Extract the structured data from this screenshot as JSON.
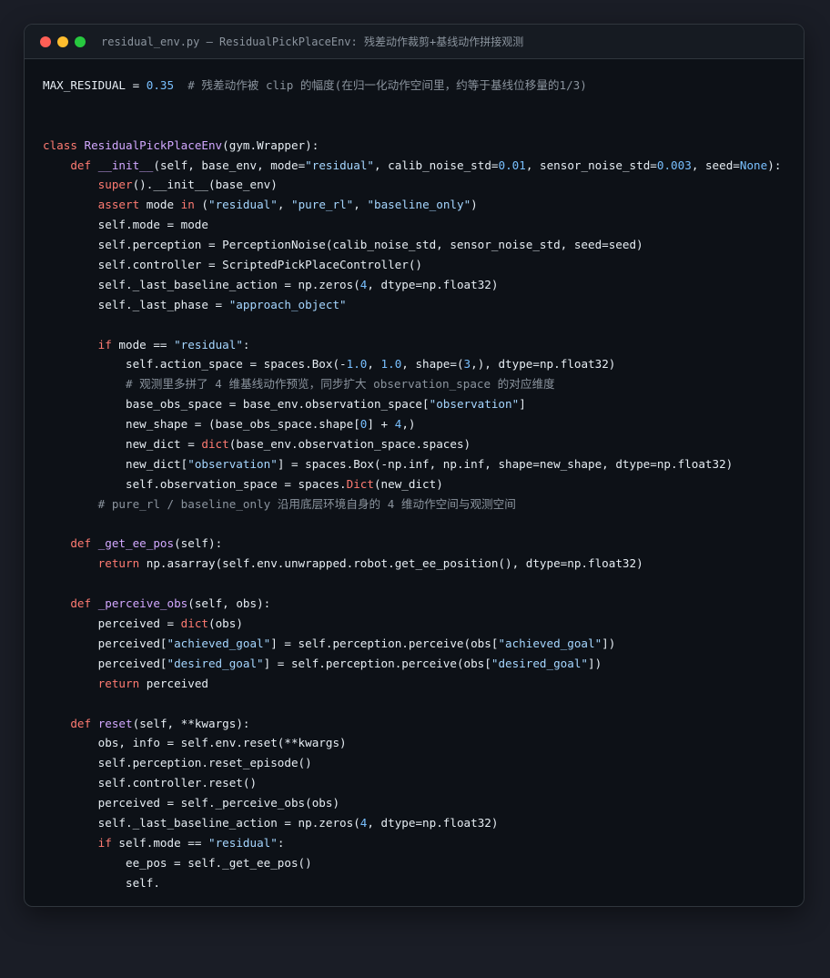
{
  "window": {
    "title": "residual_env.py — ResidualPickPlaceEnv: 残差动作裁剪+基线动作拼接观测"
  },
  "code_lines": [
    [
      [
        "MAX_RESIDUAL = ",
        ""
      ],
      [
        "0.35",
        "n"
      ],
      [
        "  # 残差动作被 clip 的幅度(在归一化动作空间里，约等于基线位移量的1/3)",
        "c"
      ]
    ],
    [],
    [],
    [
      [
        "class ",
        "k"
      ],
      [
        "ResidualPickPlaceEnv",
        "f"
      ],
      [
        "(gym.Wrapper):",
        ""
      ]
    ],
    [
      [
        "    ",
        ""
      ],
      [
        "def ",
        "k"
      ],
      [
        "__init__",
        "f"
      ],
      [
        "(self, base_env, mode=",
        ""
      ],
      [
        "\"residual\"",
        "s"
      ],
      [
        ", calib_noise_std=",
        ""
      ],
      [
        "0.01",
        "n"
      ],
      [
        ", sensor_noise_std=",
        ""
      ],
      [
        "0.003",
        "n"
      ],
      [
        ", seed=",
        ""
      ],
      [
        "None",
        "n"
      ],
      [
        "):",
        ""
      ]
    ],
    [
      [
        "        ",
        ""
      ],
      [
        "super",
        "k"
      ],
      [
        "().__init__(base_env)",
        ""
      ]
    ],
    [
      [
        "        ",
        ""
      ],
      [
        "assert ",
        "k"
      ],
      [
        "mode ",
        ""
      ],
      [
        "in ",
        "k"
      ],
      [
        "(",
        ""
      ],
      [
        "\"residual\"",
        "s"
      ],
      [
        ", ",
        ""
      ],
      [
        "\"pure_rl\"",
        "s"
      ],
      [
        ", ",
        ""
      ],
      [
        "\"baseline_only\"",
        "s"
      ],
      [
        ")",
        ""
      ]
    ],
    [
      [
        "        self.mode = mode",
        ""
      ]
    ],
    [
      [
        "        self.perception = PerceptionNoise(calib_noise_std, sensor_noise_std, seed=seed)",
        ""
      ]
    ],
    [
      [
        "        self.controller = ScriptedPickPlaceController()",
        ""
      ]
    ],
    [
      [
        "        self._last_baseline_action = np.zeros(",
        ""
      ],
      [
        "4",
        "n"
      ],
      [
        ", dtype=np.float32)",
        ""
      ]
    ],
    [
      [
        "        self._last_phase = ",
        ""
      ],
      [
        "\"approach_object\"",
        "s"
      ]
    ],
    [],
    [
      [
        "        ",
        ""
      ],
      [
        "if ",
        "k"
      ],
      [
        "mode == ",
        ""
      ],
      [
        "\"residual\"",
        "s"
      ],
      [
        ":",
        ""
      ]
    ],
    [
      [
        "            self.action_space = spaces.Box(-",
        ""
      ],
      [
        "1.0",
        "n"
      ],
      [
        ", ",
        ""
      ],
      [
        "1.0",
        "n"
      ],
      [
        ", shape=(",
        ""
      ],
      [
        "3",
        "n"
      ],
      [
        ",), dtype=np.float32)",
        ""
      ]
    ],
    [
      [
        "            ",
        ""
      ],
      [
        "# 观测里多拼了 4 维基线动作预览，同步扩大 observation_space 的对应维度",
        "c"
      ]
    ],
    [
      [
        "            base_obs_space = base_env.observation_space[",
        ""
      ],
      [
        "\"observation\"",
        "s"
      ],
      [
        "]",
        ""
      ]
    ],
    [
      [
        "            new_shape = (base_obs_space.shape[",
        ""
      ],
      [
        "0",
        "n"
      ],
      [
        "] + ",
        ""
      ],
      [
        "4",
        "n"
      ],
      [
        ",)",
        ""
      ]
    ],
    [
      [
        "            new_dict = ",
        ""
      ],
      [
        "dict",
        "k"
      ],
      [
        "(base_env.observation_space.spaces)",
        ""
      ]
    ],
    [
      [
        "            new_dict[",
        ""
      ],
      [
        "\"observation\"",
        "s"
      ],
      [
        "] = spaces.Box(-np.inf, np.inf, shape=new_shape, dtype=np.float32)",
        ""
      ]
    ],
    [
      [
        "            self.observation_space = spaces.",
        ""
      ],
      [
        "Dict",
        "k"
      ],
      [
        "(new_dict)",
        ""
      ]
    ],
    [
      [
        "        ",
        ""
      ],
      [
        "# pure_rl / baseline_only 沿用底层环境自身的 4 维动作空间与观测空间",
        "c"
      ]
    ],
    [],
    [
      [
        "    ",
        ""
      ],
      [
        "def ",
        "k"
      ],
      [
        "_get_ee_pos",
        "f"
      ],
      [
        "(self):",
        ""
      ]
    ],
    [
      [
        "        ",
        ""
      ],
      [
        "return ",
        "k"
      ],
      [
        "np.asarray(self.env.unwrapped.robot.get_ee_position(), dtype=np.float32)",
        ""
      ]
    ],
    [],
    [
      [
        "    ",
        ""
      ],
      [
        "def ",
        "k"
      ],
      [
        "_perceive_obs",
        "f"
      ],
      [
        "(self, obs):",
        ""
      ]
    ],
    [
      [
        "        perceived = ",
        ""
      ],
      [
        "dict",
        "k"
      ],
      [
        "(obs)",
        ""
      ]
    ],
    [
      [
        "        perceived[",
        ""
      ],
      [
        "\"achieved_goal\"",
        "s"
      ],
      [
        "] = self.perception.perceive(obs[",
        ""
      ],
      [
        "\"achieved_goal\"",
        "s"
      ],
      [
        "])",
        ""
      ]
    ],
    [
      [
        "        perceived[",
        ""
      ],
      [
        "\"desired_goal\"",
        "s"
      ],
      [
        "] = self.perception.perceive(obs[",
        ""
      ],
      [
        "\"desired_goal\"",
        "s"
      ],
      [
        "])",
        ""
      ]
    ],
    [
      [
        "        ",
        ""
      ],
      [
        "return ",
        "k"
      ],
      [
        "perceived",
        ""
      ]
    ],
    [],
    [
      [
        "    ",
        ""
      ],
      [
        "def ",
        "k"
      ],
      [
        "reset",
        "f"
      ],
      [
        "(self, **kwargs):",
        ""
      ]
    ],
    [
      [
        "        obs, info = self.env.reset(**kwargs)",
        ""
      ]
    ],
    [
      [
        "        self.perception.reset_episode()",
        ""
      ]
    ],
    [
      [
        "        self.controller.reset()",
        ""
      ]
    ],
    [
      [
        "        perceived = self._perceive_obs(obs)",
        ""
      ]
    ],
    [
      [
        "        self._last_baseline_action = np.zeros(",
        ""
      ],
      [
        "4",
        "n"
      ],
      [
        ", dtype=np.float32)",
        ""
      ]
    ],
    [
      [
        "        ",
        ""
      ],
      [
        "if ",
        "k"
      ],
      [
        "self.mode == ",
        ""
      ],
      [
        "\"residual\"",
        "s"
      ],
      [
        ":",
        ""
      ]
    ],
    [
      [
        "            ee_pos = self._get_ee_pos()",
        ""
      ]
    ],
    [
      [
        "            self.",
        ""
      ]
    ]
  ]
}
